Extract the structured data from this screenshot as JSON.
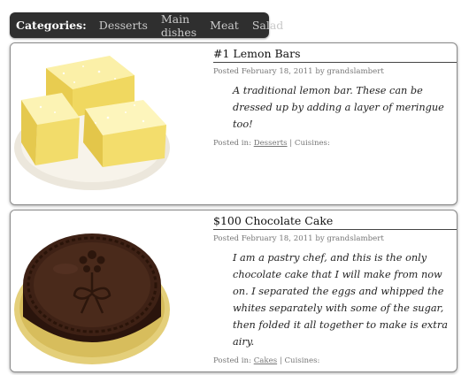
{
  "categories": {
    "label": "Categories:",
    "items": [
      "Desserts",
      "Main dishes",
      "Meat",
      "Salad"
    ]
  },
  "posts": [
    {
      "title": "#1 Lemon Bars",
      "meta": "Posted February 18, 2011 by grandslambert",
      "description": "A traditional lemon bar. These can be dressed up by adding a layer of meringue too!",
      "posted_in_label": "Posted in:",
      "category": "Desserts",
      "cuisines_label": "| Cuisines:",
      "image": "lemon-bars-photo"
    },
    {
      "title": "$100 Chocolate Cake",
      "meta": "Posted February 18, 2011 by grandslambert",
      "description": "I am a pastry chef, and this is the only chocolate cake that I will make from now on. I separated the eggs and whipped the whites separately with some of the sugar, then folded it all together to make is extra airy.",
      "posted_in_label": "Posted in:",
      "category": "Cakes",
      "cuisines_label": "| Cuisines:",
      "image": "chocolate-cake-photo"
    }
  ],
  "colors": {
    "category_bar": "#2f2f2f",
    "category_text": "#c9c9c9",
    "card_border": "#8a8a8a"
  }
}
